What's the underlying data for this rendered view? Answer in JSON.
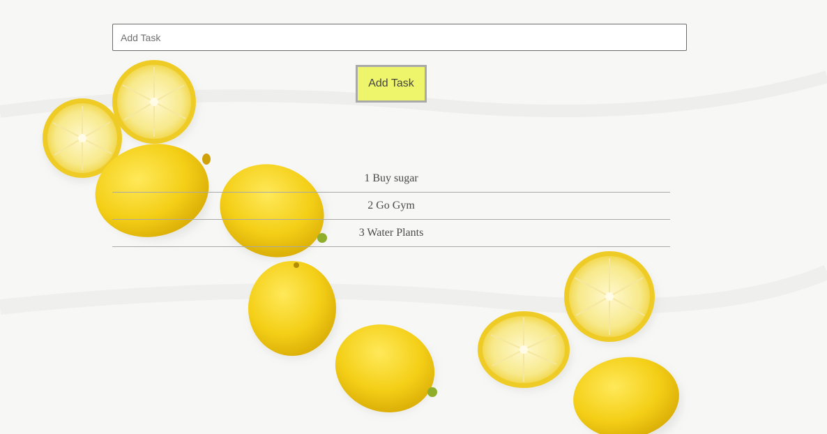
{
  "task_input": {
    "placeholder": "Add Task",
    "value": ""
  },
  "add_button": {
    "label": "Add Task",
    "color": "#eef56a"
  },
  "tasks": [
    {
      "number": "1",
      "text": "Buy sugar",
      "display": "1 Buy sugar"
    },
    {
      "number": "2",
      "text": "Go Gym",
      "display": "2 Go Gym"
    },
    {
      "number": "3",
      "text": "Water Plants",
      "display": "3 Water Plants"
    }
  ],
  "background": {
    "image": "lemons-photo",
    "color": "#f7f7f6",
    "lemon_color": "#f2cf1d"
  }
}
